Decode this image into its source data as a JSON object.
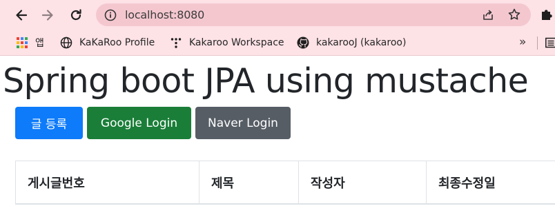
{
  "browser": {
    "url": "localhost:8080",
    "bookmarks": [
      {
        "label": "앱",
        "icon": "apps-grid-icon"
      },
      {
        "label": "KaKaRoo Profile",
        "icon": "globe-icon"
      },
      {
        "label": "Kakaroo Workspace",
        "icon": "workspace-icon"
      },
      {
        "label": "kakarooJ (kakaroo)",
        "icon": "github-icon"
      }
    ],
    "overflow_label": "»"
  },
  "page": {
    "title": "Spring boot JPA using mustache",
    "buttons": {
      "register": "글 등록",
      "google_login": "Google Login",
      "naver_login": "Naver Login"
    },
    "table": {
      "headers": [
        "게시글번호",
        "제목",
        "작성자",
        "최종수정일"
      ]
    }
  },
  "colors": {
    "chrome_bg": "#fde2e6",
    "omnibox_bg": "#f4c7cf",
    "primary": "#0d7bfa",
    "success": "#1a7e38",
    "secondary": "#565d65"
  }
}
